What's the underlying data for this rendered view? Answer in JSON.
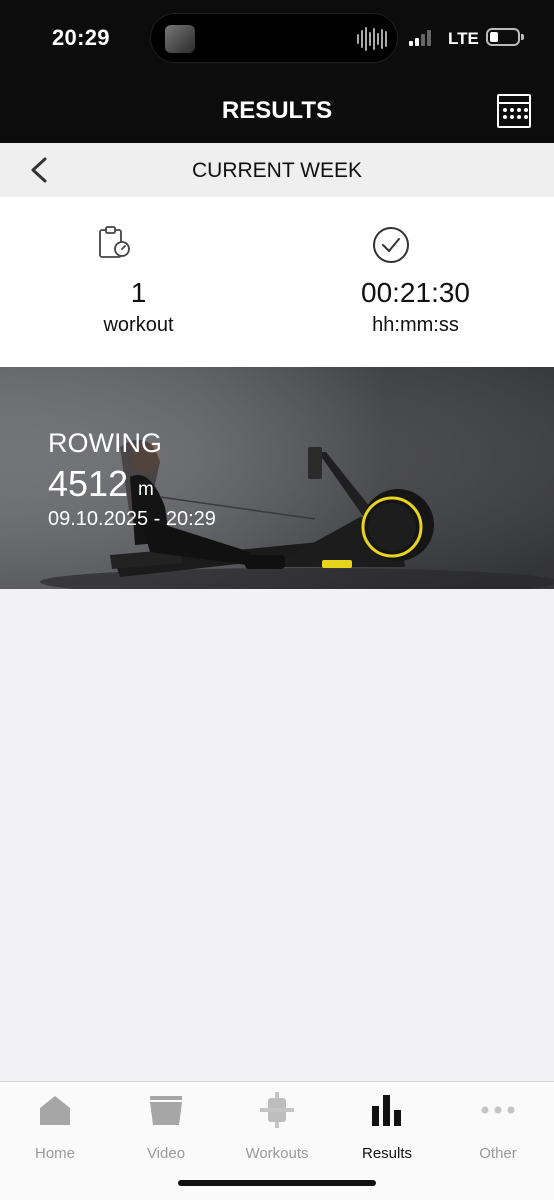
{
  "status_bar": {
    "time": "20:29",
    "network": "LTE"
  },
  "header": {
    "title": "RESULTS",
    "calendar_icon": "calendar-icon"
  },
  "subheader": {
    "title": "CURRENT WEEK",
    "back_icon": "chevron-left-icon"
  },
  "stats": {
    "workouts": {
      "value": "1",
      "unit": "workout",
      "icon": "clipboard-timer-icon"
    },
    "duration": {
      "value": "00:21:30",
      "unit": "hh:mm:ss",
      "icon": "clock-check-icon"
    }
  },
  "workout_card": {
    "type": "ROWING",
    "distance": "4512",
    "distance_unit": "m",
    "datetime": "09.10.2025 - 20:29"
  },
  "tabbar": {
    "tabs": [
      {
        "label": "Home",
        "icon": "home-icon",
        "active": false
      },
      {
        "label": "Video",
        "icon": "video-icon",
        "active": false
      },
      {
        "label": "Workouts",
        "icon": "dumbbell-icon",
        "active": false
      },
      {
        "label": "Results",
        "icon": "bar-chart-icon",
        "active": true
      },
      {
        "label": "Other",
        "icon": "more-dots-icon",
        "active": false
      }
    ]
  },
  "colors": {
    "accent_yellow": "#e8d41a",
    "top_bar": "#0c0c0c",
    "background": "#f2f2f6"
  }
}
